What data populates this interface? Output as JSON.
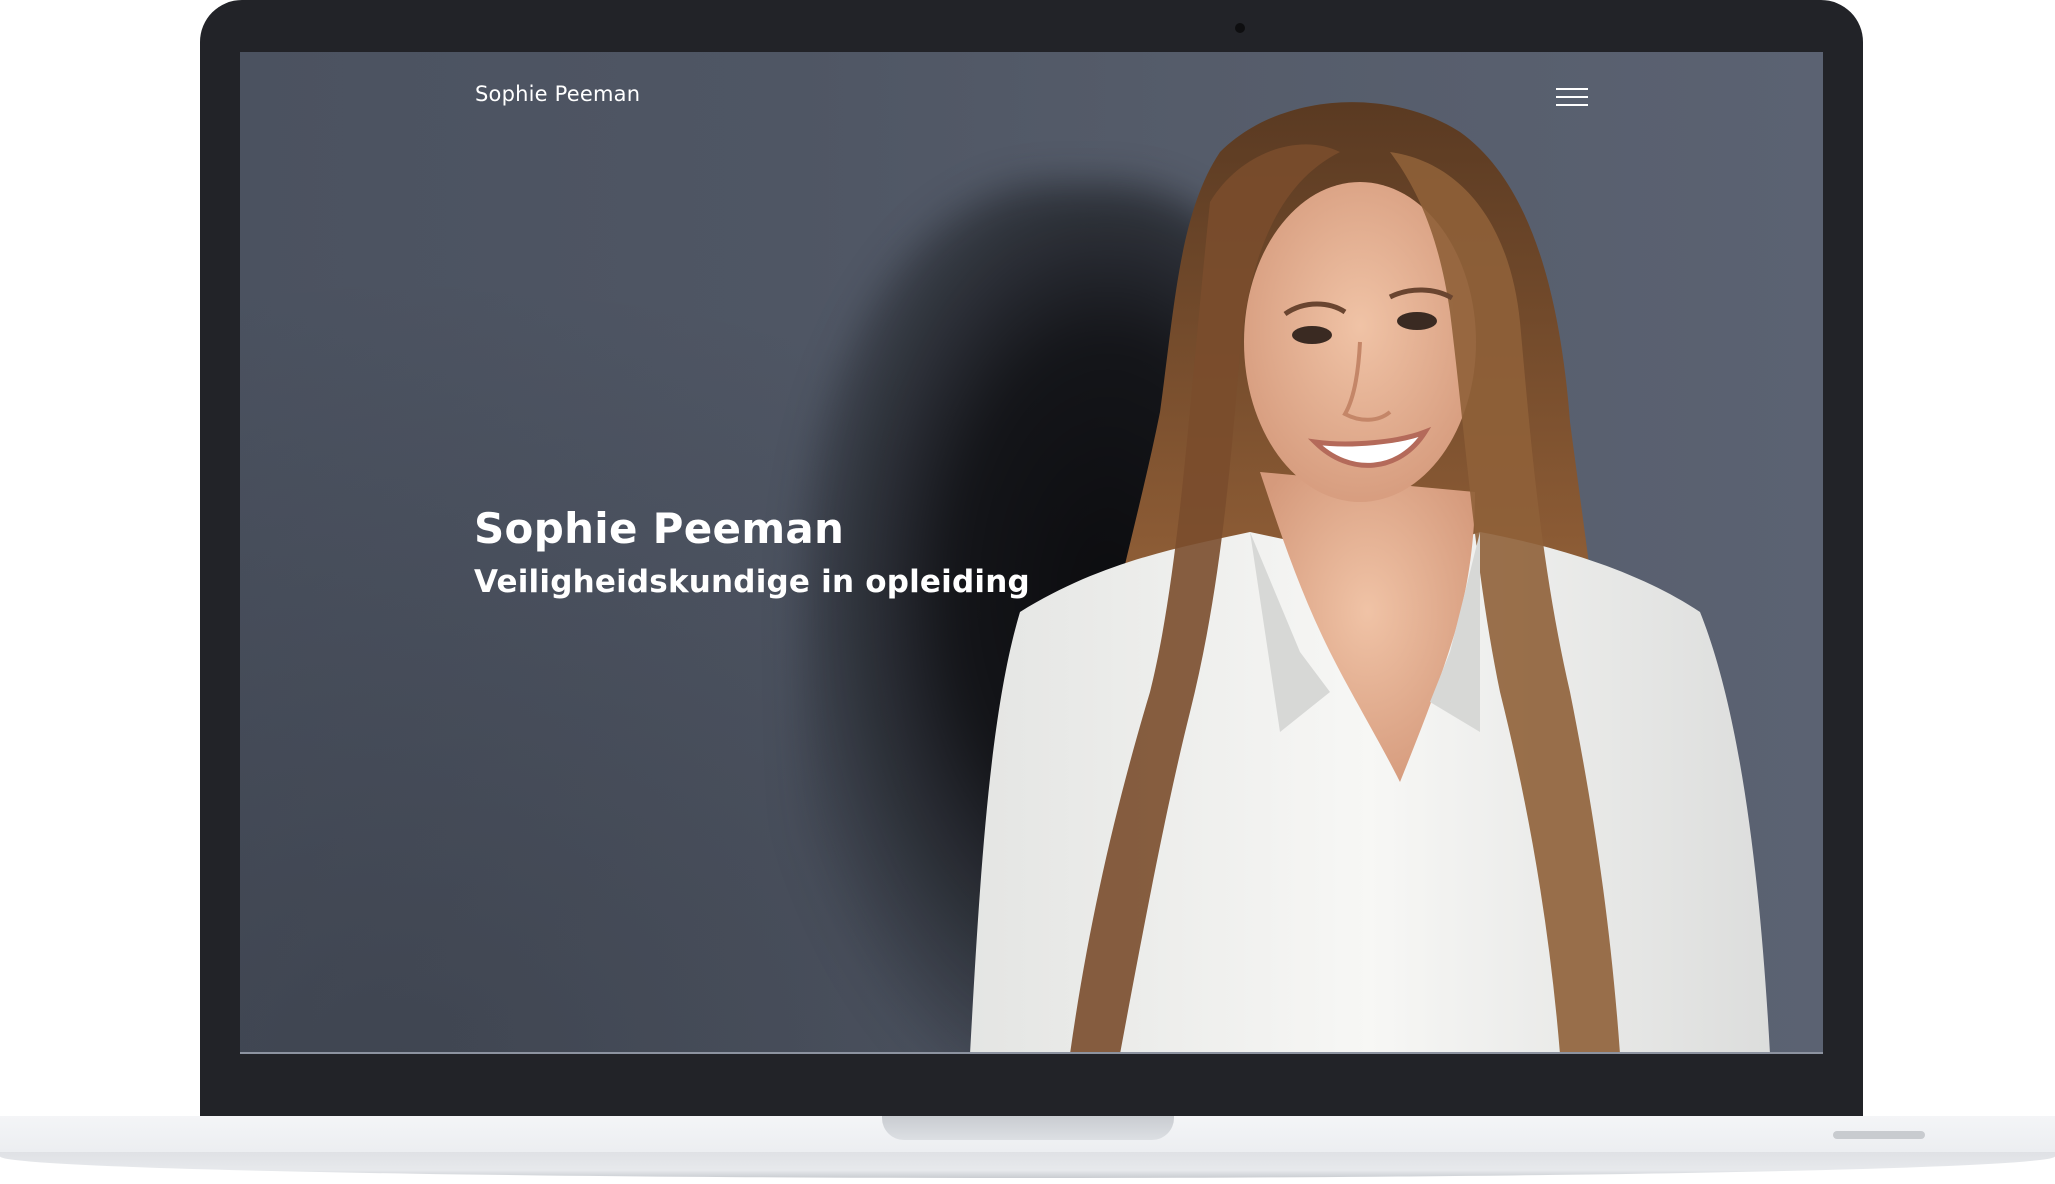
{
  "site": {
    "brand": "Sophie Peeman",
    "menu_icon": "hamburger-menu-icon"
  },
  "hero": {
    "title": "Sophie Peeman",
    "subtitle": "Veiligheidskundige in opleiding"
  },
  "colors": {
    "bezel": "#222328",
    "screen_background": "#4f5664",
    "text": "#ffffff",
    "shirt": "#f2f2f0",
    "hair": "#8a5a34"
  }
}
